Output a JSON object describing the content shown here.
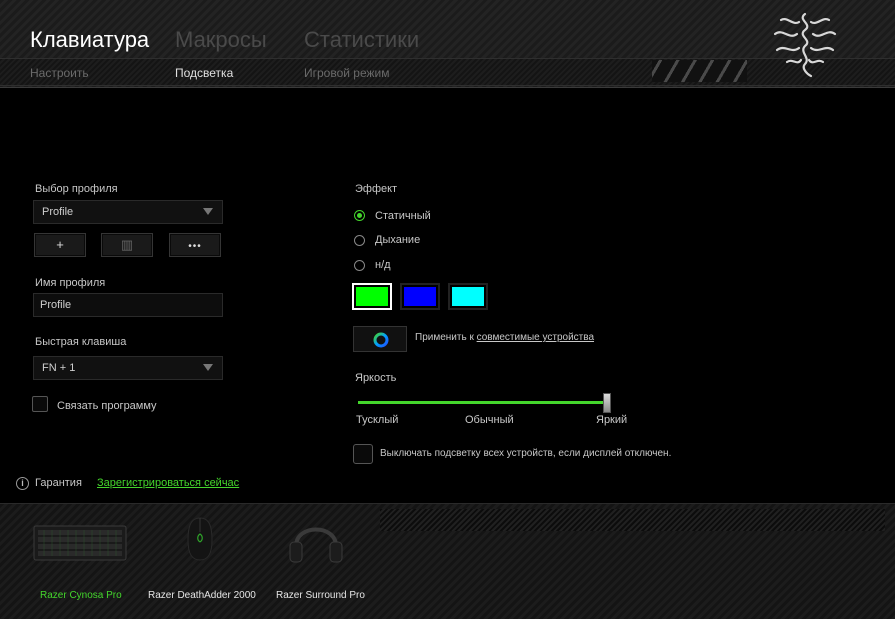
{
  "header": {
    "main_tabs": [
      "Клавиатура",
      "Макросы",
      "Статистики"
    ],
    "active_main_tab": "Клавиатура",
    "sub_tabs": [
      "Настроить",
      "Подсветка",
      "Игровой режим"
    ],
    "active_sub_tab": "Подсветка",
    "logo_icon": "razer-snake-logo-icon"
  },
  "profile": {
    "select_label": "Выбор профиля",
    "selected_profile": "Profile",
    "buttons": [
      {
        "icon": "plus-icon",
        "glyph": "+"
      },
      {
        "icon": "trash-icon",
        "glyph": "▥"
      },
      {
        "icon": "more-options-icon",
        "glyph": "•••"
      }
    ],
    "name_label": "Имя профиля",
    "name_value": "Profile",
    "hotkey_label": "Быстрая клавиша",
    "hotkey_value": "FN + 1",
    "link_program_label": "Связать программу",
    "link_program_checked": false
  },
  "effect": {
    "label": "Эффект",
    "options": [
      "Статичный",
      "Дыхание",
      "н/д"
    ],
    "selected": "Статичный",
    "colors": [
      "#00ff00",
      "#0000ff",
      "#00ffff"
    ],
    "selected_color": "#00ff00",
    "apply_prefix": "Применить к",
    "apply_link": "совместимые устройства"
  },
  "brightness": {
    "label": "Яркость",
    "ticks": [
      "Тусклый",
      "Обычный",
      "Яркий"
    ],
    "level_fraction": 1.0
  },
  "screen_off": {
    "label": "Выключать подсветку всех устройств, если дисплей отключен.",
    "checked": false
  },
  "warranty": {
    "label": "Гарантия",
    "link": "Зарегистрироваться сейчас"
  },
  "devices": [
    {
      "name": "Razer Cynosa Pro",
      "icon": "keyboard-icon",
      "active": true
    },
    {
      "name": "Razer DeathAdder 2000",
      "icon": "mouse-icon",
      "active": false
    },
    {
      "name": "Razer Surround Pro",
      "icon": "headset-icon",
      "active": false
    }
  ],
  "colors": {
    "accent": "#44d62c",
    "background": "#000000"
  }
}
